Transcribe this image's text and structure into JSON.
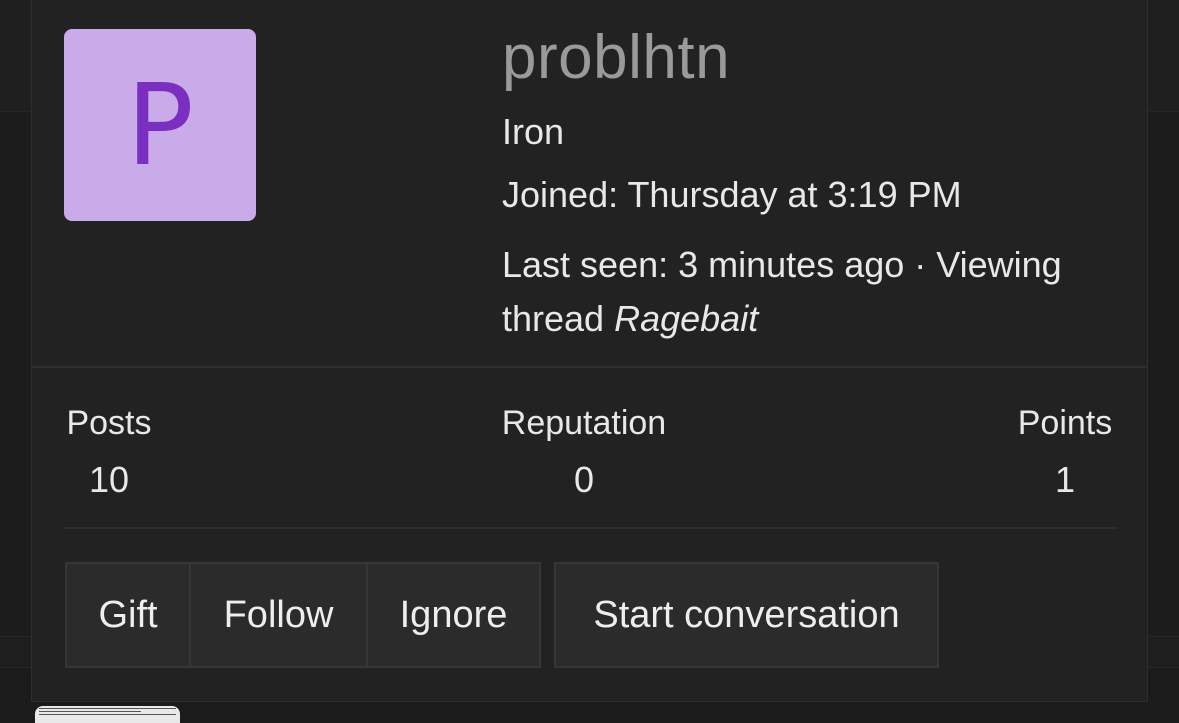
{
  "profile": {
    "avatar_letter": "P",
    "avatar_color": "#c9abe9",
    "avatar_letter_color": "#7a2fc0",
    "username": "problhtn",
    "rank": "Iron",
    "joined": "Joined: Thursday at 3:19 PM",
    "last_seen_prefix": "Last seen: 3 minutes ago · Viewing thread",
    "last_seen_thread": "Ragebait"
  },
  "stats": {
    "posts_label": "Posts",
    "posts_value": "10",
    "reputation_label": "Reputation",
    "reputation_value": "0",
    "points_label": "Points",
    "points_value": "1"
  },
  "actions": {
    "gift": "Gift",
    "follow": "Follow",
    "ignore": "Ignore",
    "start_conversation": "Start conversation"
  }
}
